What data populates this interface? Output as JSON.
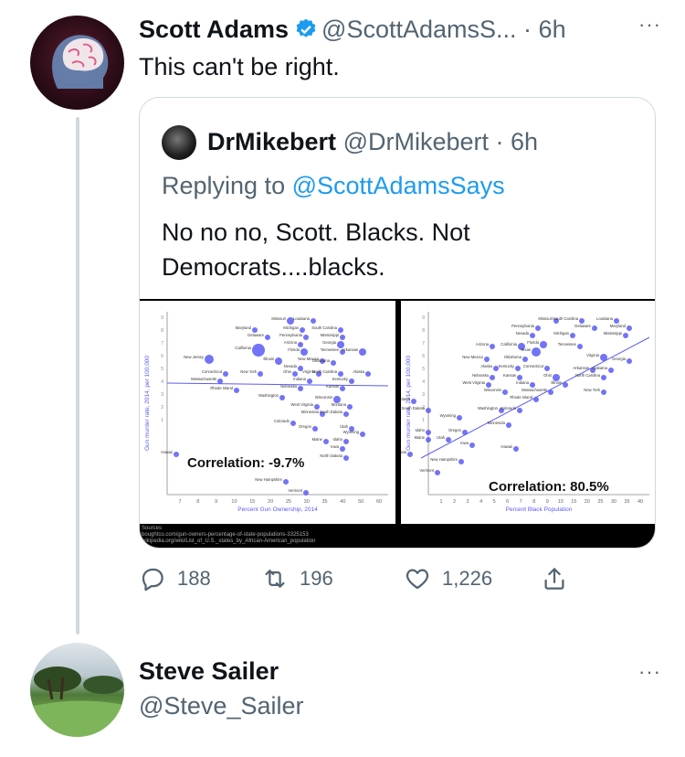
{
  "tweet": {
    "author_name": "Scott Adams",
    "author_handle": "@ScottAdamsS...",
    "separator": "·",
    "time": "6h",
    "text": "This can't be right.",
    "more": "···"
  },
  "quote": {
    "author_name": "DrMikebert",
    "author_handle": "@DrMikebert",
    "separator": "·",
    "time": "6h",
    "replying_prefix": "Replying to",
    "replying_to": "@ScottAdamsSays",
    "text": "No no no, Scott. Blacks. Not Democrats....blacks."
  },
  "chart_data": [
    {
      "type": "scatter",
      "title": "Correlation: -9.7%",
      "xlabel": "Percent Gun Ownership, 2014",
      "ylabel": "Gun murder rate, 2014, per 100,000",
      "x_scale": "log",
      "y_scale": "log",
      "x_ticks": [
        "7",
        "8",
        "9",
        "10",
        "15",
        "20",
        "25",
        "30",
        "35",
        "40",
        "50",
        "60"
      ],
      "y_ticks": [
        "1",
        "2",
        "3",
        "4",
        "5",
        "6",
        "7",
        "8",
        "9"
      ],
      "labels": [
        "Louisiana",
        "Missouri",
        "Maryland",
        "Michigan",
        "South Carolina",
        "Delaware",
        "Pennsylvania",
        "Mississippi",
        "Arizona",
        "Georgia",
        "California",
        "Florida",
        "Tennessee",
        "Arkansas",
        "New Jersey",
        "Illinois",
        "New Mexico",
        "Oklahoma",
        "Nevada",
        "Connecticut",
        "New York",
        "Ohio",
        "Virginia",
        "North Carolina",
        "Alaska",
        "Massachusetts",
        "Indiana",
        "Kentucky",
        "Rhode Island",
        "Nebraska",
        "Kansas",
        "Washington",
        "Wisconsin",
        "Montana",
        "West Virginia",
        "Minnesota",
        "South Dakota",
        "Colorado",
        "Oregon",
        "Utah",
        "Wyoming",
        "Maine",
        "Idaho",
        "Iowa",
        "Hawaii",
        "North Dakota",
        "New Hampshire",
        "Vermont"
      ]
    },
    {
      "type": "scatter",
      "title": "Correlation: 80.5%",
      "xlabel": "Percent Black Population",
      "ylabel": "Gun murder rate, 2014, per 100,000",
      "x_scale": "log",
      "y_scale": "log",
      "x_ticks": [
        "1",
        "2",
        "3",
        "4",
        "5",
        "6",
        "7",
        "8",
        "9",
        "10",
        "15",
        "20",
        "25",
        "30",
        "35",
        "40"
      ],
      "y_ticks": [
        "1",
        "2",
        "3",
        "4",
        "5",
        "6",
        "7",
        "8",
        "9"
      ],
      "labels": [
        "Missouri",
        "South Carolina",
        "Louisiana",
        "Pennsylvania",
        "Delaware",
        "Maryland",
        "Nevada",
        "Michigan",
        "Mississippi",
        "Arizona",
        "California",
        "Florida",
        "Tennessee",
        "Texas",
        "New Mexico",
        "Oklahoma",
        "Virginia",
        "Georgia",
        "Alaska",
        "Kentucky",
        "Connecticut",
        "Arkansas",
        "Alabama",
        "Nebraska",
        "Kansas",
        "Ohio",
        "North Carolina",
        "West Virginia",
        "Indiana",
        "Illinois",
        "Wisconsin",
        "Massachusetts",
        "New York",
        "Rhode Island",
        "Montana",
        "South Dakota",
        "Washington",
        "Colorado",
        "Wyoming",
        "Minnesota",
        "Idaho",
        "Oregon",
        "Maine",
        "Utah",
        "Iowa",
        "Hawaii",
        "North Dakota",
        "New Hampshire",
        "Vermont"
      ]
    }
  ],
  "sources": {
    "heading": "Sources",
    "line1": "boughtco.com/gun-owners-percentage-of-state-populations-3325153",
    "line2": "wikipedia.org/wiki/List_of_U.S._states_by_African-American_population"
  },
  "actions": {
    "reply_count": "188",
    "retweet_count": "196",
    "like_count": "1,226"
  },
  "next_tweet": {
    "author_name": "Steve Sailer",
    "author_handle": "@Steve_Sailer",
    "more": "···"
  },
  "colors": {
    "text": "#0f1419",
    "secondary": "#536471",
    "link": "#1d9bf0",
    "verified": "#1d9bf0",
    "border": "#cfd9de",
    "chart_points": "#5b5bf5"
  },
  "icons": [
    "verified-badge-icon",
    "more-icon",
    "reply-icon",
    "retweet-icon",
    "like-icon",
    "share-icon"
  ]
}
